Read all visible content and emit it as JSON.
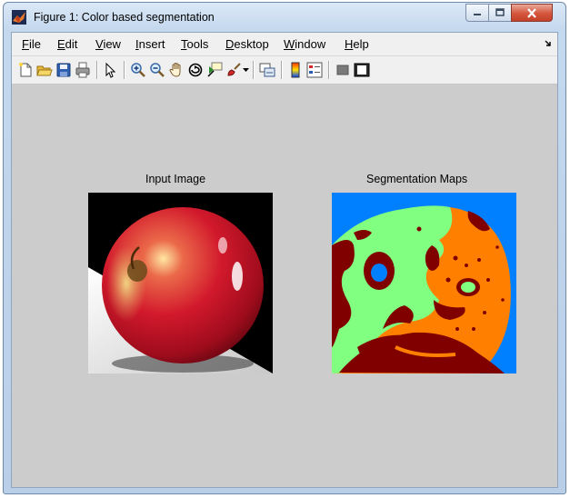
{
  "window": {
    "title": "Figure 1: Color based segmentation",
    "controls": [
      "minimize-icon",
      "maximize-icon",
      "close-icon"
    ]
  },
  "menu": {
    "items": [
      {
        "label": "File",
        "mnemonic": "F",
        "rest": "ile"
      },
      {
        "label": "Edit",
        "mnemonic": "E",
        "rest": "dit"
      },
      {
        "label": "View",
        "mnemonic": "V",
        "rest": "iew"
      },
      {
        "label": "Insert",
        "mnemonic": "I",
        "rest": "nsert"
      },
      {
        "label": "Tools",
        "mnemonic": "T",
        "rest": "ools"
      },
      {
        "label": "Desktop",
        "mnemonic": "D",
        "rest": "esktop"
      },
      {
        "label": "Window",
        "mnemonic": "W",
        "rest": "indow"
      },
      {
        "label": "Help",
        "mnemonic": "H",
        "rest": "elp"
      }
    ]
  },
  "toolbar": {
    "icons": [
      "new-figure-icon",
      "open-file-icon",
      "save-icon",
      "print-icon",
      "edit-plot-icon",
      "zoom-in-icon",
      "zoom-out-icon",
      "pan-icon",
      "rotate-3d-icon",
      "data-cursor-icon",
      "brush-icon",
      "brush-dropdown-icon",
      "link-plot-icon",
      "insert-colorbar-icon",
      "insert-legend-icon",
      "hide-plot-tools-icon",
      "show-plot-tools-icon"
    ]
  },
  "figure": {
    "background": "#cccccc",
    "axes": [
      {
        "title": "Input Image",
        "content": "apple photograph"
      },
      {
        "title": "Segmentation Maps",
        "content": "color-segmented map",
        "colors": [
          "#0080ff",
          "#80ff80",
          "#ff8000",
          "#800000"
        ]
      }
    ]
  }
}
